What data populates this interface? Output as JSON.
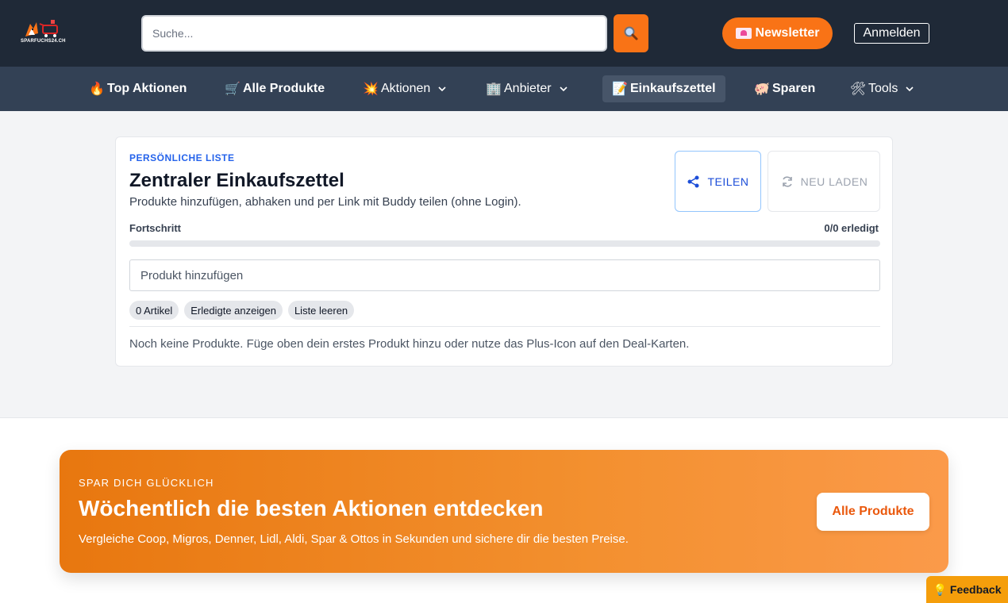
{
  "header": {
    "logo_text": "SPARFUCHS24.CH",
    "search_placeholder": "Suche...",
    "newsletter_label": "Newsletter",
    "login_label": "Anmelden"
  },
  "nav": {
    "items": [
      {
        "emoji": "🔥",
        "label": "Top Aktionen"
      },
      {
        "emoji": "🛒",
        "label": "Alle Produkte"
      },
      {
        "emoji": "💥",
        "label": "Aktionen"
      },
      {
        "emoji": "🏢",
        "label": "Anbieter"
      },
      {
        "emoji": "📝",
        "label": "Einkaufszettel"
      },
      {
        "emoji": "🐖",
        "label": "Sparen"
      },
      {
        "emoji": "🛠",
        "label": "Tools"
      }
    ]
  },
  "card": {
    "kicker": "PERSÖNLICHE LISTE",
    "title": "Zentraler Einkaufszettel",
    "subtitle": "Produkte hinzufügen, abhaken und per Link mit Buddy teilen (ohne Login).",
    "share_label": "TEILEN",
    "reload_label": "NEU LADEN",
    "progress_label": "Fortschritt",
    "progress_count": "0/0 erledigt",
    "progress_fraction": 0,
    "input_placeholder": "Produkt hinzufügen",
    "chips": [
      "0 Artikel",
      "Erledigte anzeigen",
      "Liste leeren"
    ],
    "empty_text": "Noch keine Produkte. Füge oben dein erstes Produkt hinzu oder nutze das Plus-Icon auf den Deal-Karten."
  },
  "banner": {
    "kicker": "SPAR DICH GLÜCKLICH",
    "title": "Wöchentlich die besten Aktionen entdecken",
    "subtitle": "Vergleiche Coop, Migros, Denner, Lidl, Aldi, Spar & Ottos in Sekunden und sichere dir die besten Preise.",
    "button_label": "Alle Produkte"
  },
  "feedback": {
    "emoji": "💡",
    "label": "Feedback"
  },
  "colors": {
    "header_bg": "#1f2937",
    "nav_bg": "#334155",
    "accent": "#f97316",
    "link_blue": "#2563eb"
  }
}
